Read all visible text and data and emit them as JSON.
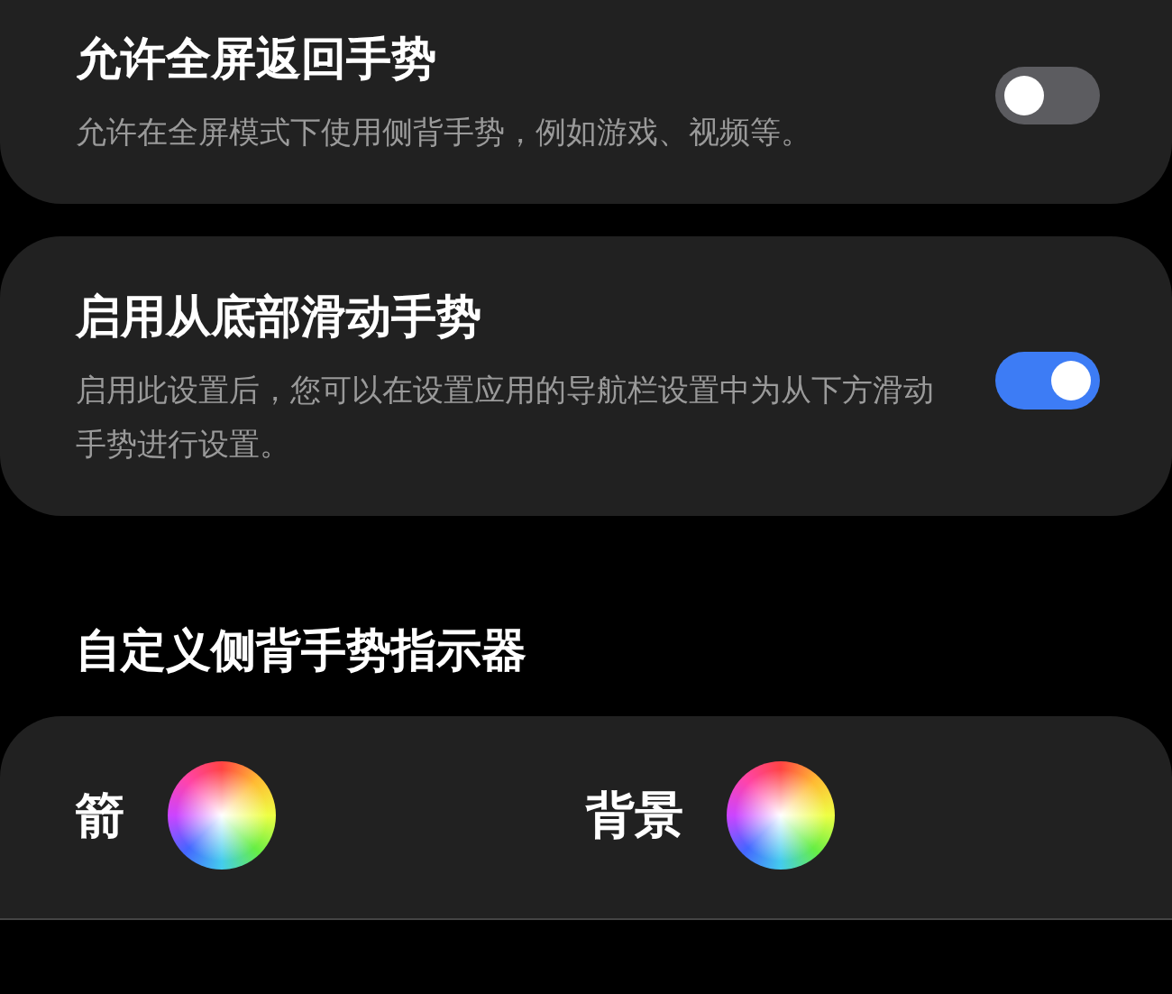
{
  "settings": [
    {
      "title": "允许全屏返回手势",
      "description": "允许在全屏模式下使用侧背手势，例如游戏、视频等。",
      "on": false
    },
    {
      "title": "启用从底部滑动手势",
      "description": "启用此设置后，您可以在设置应用的导航栏设置中为从下方滑动手势进行设置。",
      "on": true
    }
  ],
  "indicator_section": {
    "heading": "自定义侧背手势指示器",
    "colors": [
      {
        "label": "箭"
      },
      {
        "label": "背景"
      }
    ]
  }
}
